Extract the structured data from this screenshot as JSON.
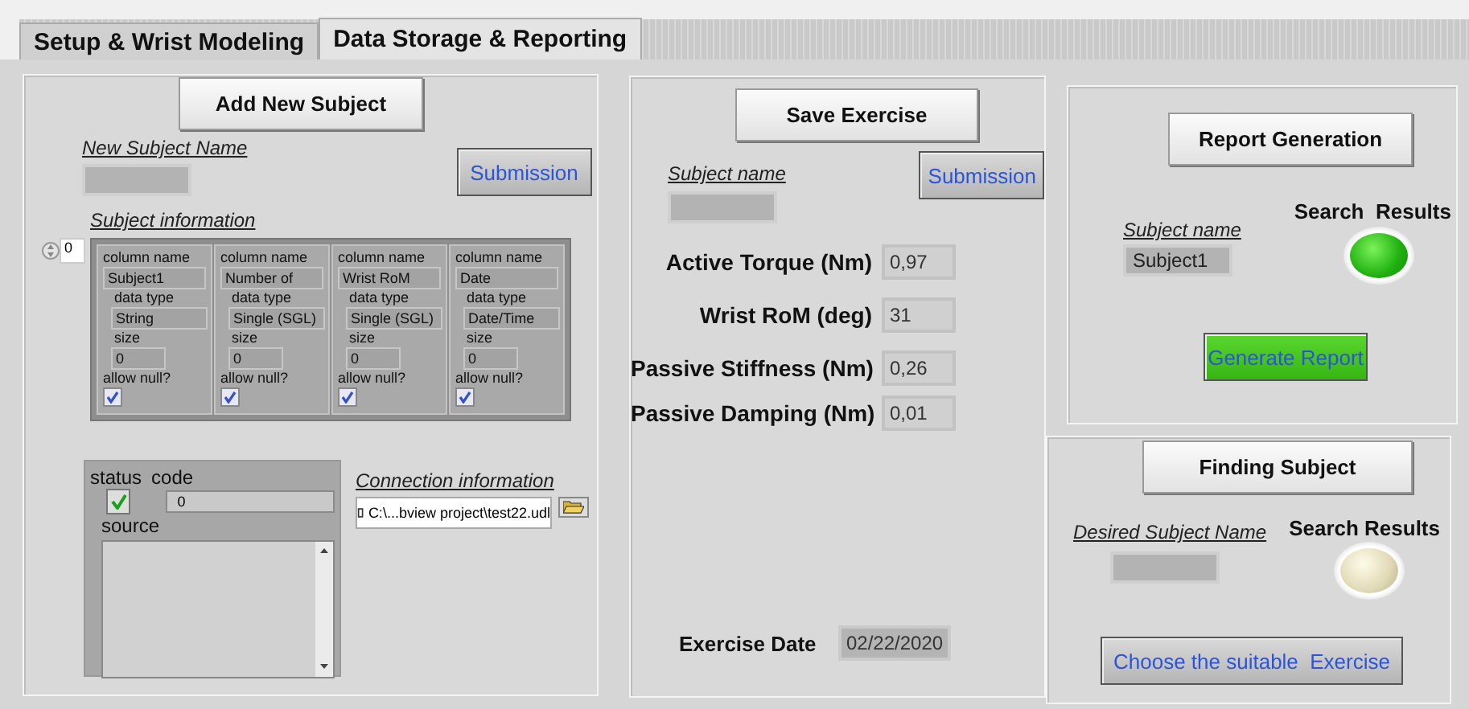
{
  "tabs": [
    {
      "label": "Setup & Wrist Modeling",
      "selected": false
    },
    {
      "label": "Data Storage & Reporting",
      "selected": true
    }
  ],
  "add_subject": {
    "button": "Add New Subject",
    "name_label": "New Subject Name",
    "submit": "Submission"
  },
  "subject_info": {
    "label": "Subject information",
    "index": "0",
    "columns": [
      {
        "name_label": "column name",
        "name": "Subject1",
        "type_label": "data type",
        "type": "String",
        "size_label": "size",
        "size": "0",
        "null_label": "allow null?",
        "allow_null": true
      },
      {
        "name_label": "column name",
        "name": "Number of",
        "type_label": "data type",
        "type": "Single (SGL)",
        "size_label": "size",
        "size": "0",
        "null_label": "allow null?",
        "allow_null": true
      },
      {
        "name_label": "column name",
        "name": "Wrist RoM",
        "type_label": "data type",
        "type": "Single (SGL)",
        "size_label": "size",
        "size": "0",
        "null_label": "allow null?",
        "allow_null": true
      },
      {
        "name_label": "column name",
        "name": "Date",
        "type_label": "data type",
        "type": "Date/Time",
        "size_label": "size",
        "size": "0",
        "null_label": "allow null?",
        "allow_null": true
      }
    ]
  },
  "error": {
    "status_label": "status",
    "status": true,
    "code_label": "code",
    "code": "0",
    "source_label": "source"
  },
  "connection": {
    "label": "Connection information",
    "path": "C:\\...bview project\\test22.udl"
  },
  "exercise": {
    "button": "Save Exercise",
    "subject_label": "Subject name",
    "submit": "Submission",
    "measures": [
      {
        "label": "Active Torque (Nm)",
        "value": "0,97"
      },
      {
        "label": "Wrist RoM (deg)",
        "value": "31"
      },
      {
        "label": "Passive Stiffness (Nm)",
        "value": "0,26"
      },
      {
        "label": "Passive Damping (Nm)",
        "value": "0,01"
      }
    ],
    "date_label": "Exercise Date",
    "date": "02/22/2020"
  },
  "report": {
    "button": "Report Generation",
    "subject_label": "Subject name",
    "subject": "Subject1",
    "results_label": "Search  Results",
    "found": true,
    "generate": "Generate Report"
  },
  "finding": {
    "button": "Finding Subject",
    "subject_label": "Desired Subject Name",
    "results_label": "Search Results",
    "found": false,
    "choose": "Choose the suitable  Exercise"
  }
}
